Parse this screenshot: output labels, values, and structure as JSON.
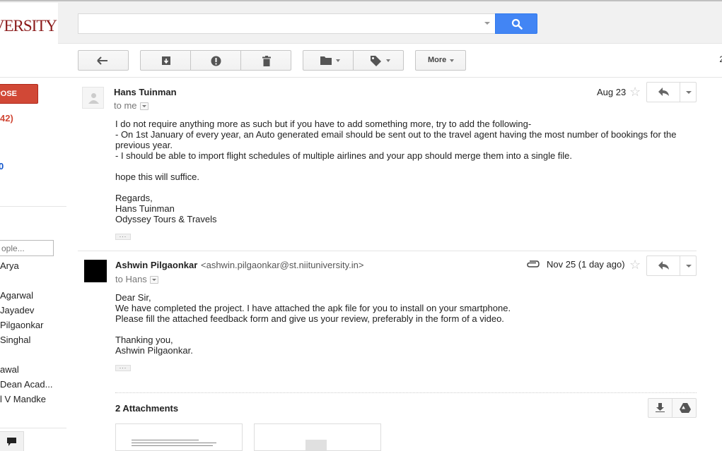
{
  "logo_text": "UNIVERSITY",
  "search": {
    "value": "",
    "placeholder": ""
  },
  "toolbar": {
    "back_icon": "arrow-left-icon",
    "archive_icon": "archive-icon",
    "spam_icon": "report-spam-icon",
    "delete_icon": "trash-icon",
    "move_icon": "folder-icon",
    "labels_icon": "tag-icon",
    "more_label": "More",
    "pager_text": "2"
  },
  "sidebar": {
    "compose_label": "POSE",
    "inbox_count": "42)",
    "blue_text": "0",
    "people_search_placeholder": "ople...",
    "contacts": [
      "Arya",
      "Agarwal",
      "Jayadev",
      "Pilgaonkar",
      "Singhal",
      "awal",
      "Dean Acad...",
      "l V Mandke"
    ]
  },
  "messages": [
    {
      "sender": "Hans Tuinman",
      "to_text": "to me",
      "date": "Aug 23",
      "body": [
        "I do not require anything more as such but if you have to add something more, try to add the following-",
        "- On 1st January of every year, an Auto generated email should be sent out to the travel agent having the most number of bookings for the",
        "previous year.",
        "- I should be able to import flight schedules of multiple airlines and your app should merge them into a single file.",
        "",
        "hope this will suffice.",
        "",
        "Regards,",
        "Hans Tuinman",
        "Odyssey Tours & Travels"
      ]
    },
    {
      "sender": "Ashwin Pilgaonkar",
      "email": "<ashwin.pilgaonkar@st.niituniversity.in>",
      "to_text": "to Hans",
      "date": "Nov 25  (1 day ago)",
      "body": [
        "Dear Sir,",
        "We have completed the project. I have attached the apk file for you to install on your smartphone.",
        "Please fill the attached feedback form and give us your review, preferably in the form of a video.",
        "",
        "Thanking you,",
        "Ashwin Pilgaonkar."
      ]
    }
  ],
  "attachments": {
    "title": "2 Attachments"
  },
  "colors": {
    "accent_blue": "#4285f4",
    "compose_red": "#d14836",
    "logo_red": "#8b1a1a"
  }
}
